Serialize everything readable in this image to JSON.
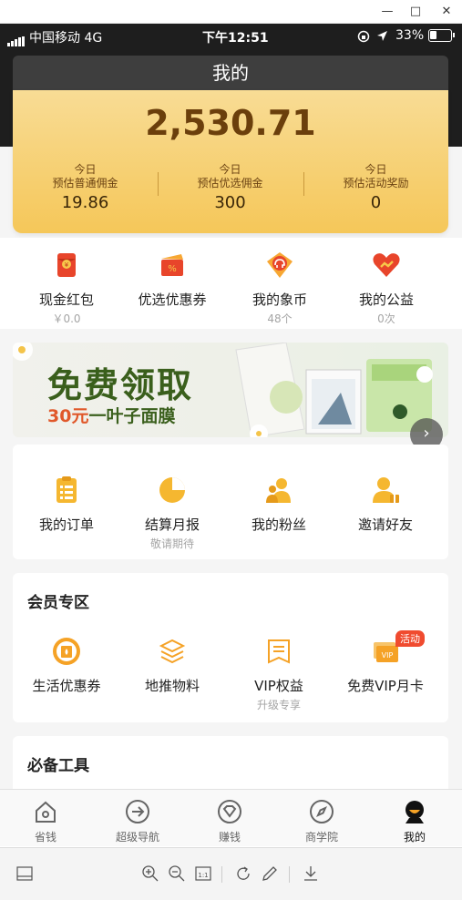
{
  "status_bar": {
    "carrier": "中国移动  4G",
    "time": "下午12:51",
    "battery": "33%",
    "battery_level": 0.33
  },
  "header": {
    "title": "我的"
  },
  "earnings": {
    "total": "2,530.71",
    "items": [
      {
        "line1": "今日",
        "line2": "预估普通佣金",
        "value": "19.86"
      },
      {
        "line1": "今日",
        "line2": "预估优选佣金",
        "value": "300"
      },
      {
        "line1": "今日",
        "line2": "预估活动奖励",
        "value": "0"
      }
    ]
  },
  "quick_entries": [
    {
      "label": "现金红包",
      "sub": "￥0.0",
      "icon": "red-envelope-icon"
    },
    {
      "label": "优选优惠券",
      "sub": "",
      "icon": "coupon-icon"
    },
    {
      "label": "我的象币",
      "sub": "48个",
      "icon": "elephant-coin-icon"
    },
    {
      "label": "我的公益",
      "sub": "0次",
      "icon": "charity-heart-icon"
    }
  ],
  "banner": {
    "title": "免费领取",
    "sub_highlight": "30元",
    "sub_rest": "一叶子面膜"
  },
  "orders_section": {
    "items": [
      {
        "label": "我的订单",
        "sub": "",
        "icon": "order-list-icon"
      },
      {
        "label": "结算月报",
        "sub": "敬请期待",
        "icon": "pie-chart-icon"
      },
      {
        "label": "我的粉丝",
        "sub": "",
        "icon": "fans-icon"
      },
      {
        "label": "邀请好友",
        "sub": "",
        "icon": "invite-friend-icon"
      }
    ]
  },
  "member_section": {
    "title": "会员专区",
    "items": [
      {
        "label": "生活优惠券",
        "sub": "",
        "icon": "life-coupon-icon"
      },
      {
        "label": "地推物料",
        "sub": "",
        "icon": "materials-stack-icon"
      },
      {
        "label": "VIP权益",
        "sub": "升级专享",
        "icon": "vip-rights-icon"
      },
      {
        "label": "免费VIP月卡",
        "sub": "",
        "icon": "vip-card-icon",
        "tag": "活动"
      }
    ]
  },
  "tools_section": {
    "title": "必备工具"
  },
  "tabbar": [
    {
      "label": "省钱",
      "icon": "home-save-icon",
      "active": false
    },
    {
      "label": "超级导航",
      "icon": "navigation-arrow-icon",
      "active": false
    },
    {
      "label": "赚钱",
      "icon": "earn-diamond-icon",
      "active": false
    },
    {
      "label": "商学院",
      "icon": "compass-icon",
      "active": false
    },
    {
      "label": "我的",
      "icon": "profile-icon",
      "active": true
    }
  ],
  "colors": {
    "gold": "#f5c759",
    "accent_orange": "#f0a21f",
    "brown_text": "#6b3f0c",
    "banner_green": "#3a5f1c",
    "hot_red": "#f04b2f"
  }
}
